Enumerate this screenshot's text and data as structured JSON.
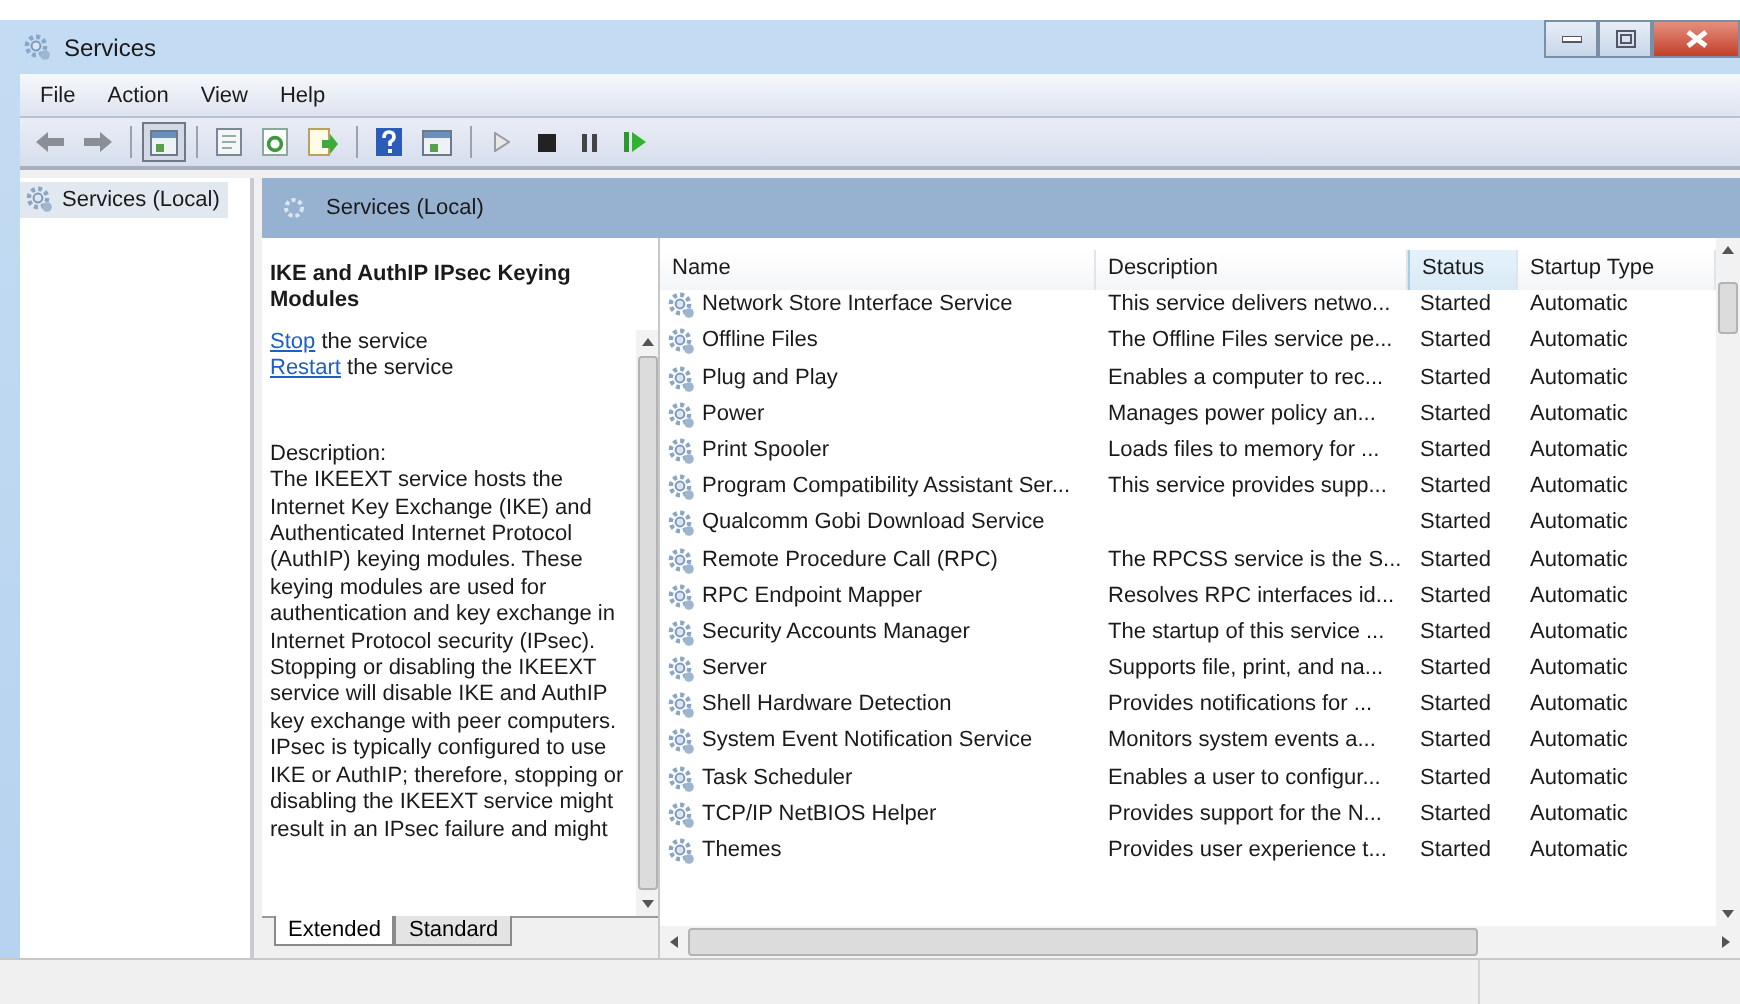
{
  "window": {
    "title": "Services"
  },
  "menu": [
    "File",
    "Action",
    "View",
    "Help"
  ],
  "toolbar": [
    {
      "kind": "back",
      "selected": false
    },
    {
      "kind": "forward",
      "selected": false
    },
    {
      "kind": "sep"
    },
    {
      "kind": "console",
      "selected": true
    },
    {
      "kind": "sep"
    },
    {
      "kind": "properties",
      "selected": false
    },
    {
      "kind": "refresh",
      "selected": false
    },
    {
      "kind": "export",
      "selected": false
    },
    {
      "kind": "sep"
    },
    {
      "kind": "help",
      "selected": false
    },
    {
      "kind": "view",
      "selected": false
    },
    {
      "kind": "sep"
    },
    {
      "kind": "start",
      "selected": false
    },
    {
      "kind": "stop",
      "selected": false
    },
    {
      "kind": "pause",
      "selected": false
    },
    {
      "kind": "resume",
      "selected": false
    }
  ],
  "tree": [
    {
      "label": "Services (Local)",
      "selected": true
    }
  ],
  "pane_header": "Services (Local)",
  "details": {
    "title": "IKE and AuthIP IPsec Keying Modules",
    "actions": [
      {
        "link": "Stop",
        "text": "the service"
      },
      {
        "link": "Restart",
        "text": "the service"
      }
    ],
    "description_label": "Description:",
    "description": "The IKEEXT service hosts the Internet Key Exchange (IKE) and Authenticated Internet Protocol (AuthIP) keying modules. These keying modules are used for authentication and key exchange in Internet Protocol security (IPsec). Stopping or disabling the IKEEXT service will disable IKE and AuthIP key exchange with peer computers. IPsec is typically configured to use IKE or AuthIP; therefore, stopping or disabling the IKEEXT service might result in an IPsec failure and might"
  },
  "table": {
    "columns": [
      {
        "label": "Name",
        "sorted": false
      },
      {
        "label": "Description",
        "sorted": false
      },
      {
        "label": "Status",
        "sorted": true
      },
      {
        "label": "Startup Type",
        "sorted": false
      }
    ],
    "rows": [
      [
        "Network Store Interface Service",
        "This service delivers netwo...",
        "Started",
        "Automatic"
      ],
      [
        "Offline Files",
        "The Offline Files service pe...",
        "Started",
        "Automatic"
      ],
      [
        "Plug and Play",
        "Enables a computer to rec...",
        "Started",
        "Automatic"
      ],
      [
        "Power",
        "Manages power policy an...",
        "Started",
        "Automatic"
      ],
      [
        "Print Spooler",
        "Loads files to memory for ...",
        "Started",
        "Automatic"
      ],
      [
        "Program Compatibility Assistant Ser...",
        "This service provides supp...",
        "Started",
        "Automatic"
      ],
      [
        "Qualcomm Gobi Download Service",
        "",
        "Started",
        "Automatic"
      ],
      [
        "Remote Procedure Call (RPC)",
        "The RPCSS service is the S...",
        "Started",
        "Automatic"
      ],
      [
        "RPC Endpoint Mapper",
        "Resolves RPC interfaces id...",
        "Started",
        "Automatic"
      ],
      [
        "Security Accounts Manager",
        "The startup of this service ...",
        "Started",
        "Automatic"
      ],
      [
        "Server",
        "Supports file, print, and na...",
        "Started",
        "Automatic"
      ],
      [
        "Shell Hardware Detection",
        "Provides notifications for ...",
        "Started",
        "Automatic"
      ],
      [
        "System Event Notification Service",
        "Monitors system events a...",
        "Started",
        "Automatic"
      ],
      [
        "Task Scheduler",
        "Enables a user to configur...",
        "Started",
        "Automatic"
      ],
      [
        "TCP/IP NetBIOS Helper",
        "Provides support for the N...",
        "Started",
        "Automatic"
      ],
      [
        "Themes",
        "Provides user experience t...",
        "Started",
        "Automatic"
      ]
    ]
  },
  "tabs": [
    {
      "label": "Extended",
      "selected": true
    },
    {
      "label": "Standard",
      "selected": false
    }
  ]
}
